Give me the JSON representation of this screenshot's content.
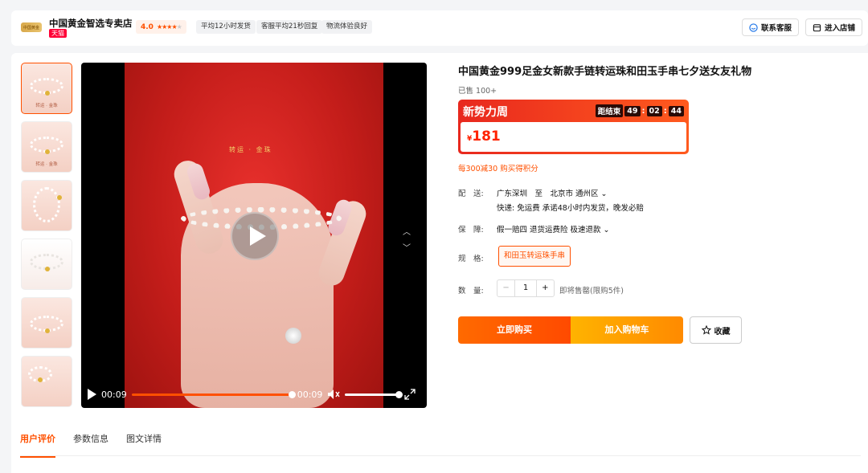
{
  "header": {
    "logo_text": "中国黄金",
    "store_name": "中国黄金智选专卖店",
    "platform_badge": "天猫",
    "rating": "4.0",
    "rating_stars": 4,
    "tags": [
      "平均12小时发货",
      "客服平均21秒回复",
      "物流体验良好"
    ],
    "contact_btn": "联系客服",
    "enter_store_btn": "进入店铺"
  },
  "gallery": {
    "thumbnails": [
      {
        "caption": "转运 · 金珠",
        "active": true
      },
      {
        "caption": "转运 · 金珠",
        "active": false
      },
      {
        "caption": "",
        "active": false
      },
      {
        "caption": "",
        "active": false
      },
      {
        "caption": "",
        "active": false
      },
      {
        "caption": "",
        "active": false
      }
    ]
  },
  "video": {
    "caption": "转运 · 金珠",
    "current_time": "00:09",
    "duration": "00:09",
    "progress": 1.0,
    "volume": 1.0
  },
  "product": {
    "title": "中国黄金999足金女新款手链转运珠和田玉手串七夕送女友礼物",
    "sold": "已售 100+",
    "promo": {
      "name": "新势力周",
      "countdown_label": "距结束",
      "hours": "49",
      "minutes": "02",
      "seconds": "44"
    },
    "price_currency": "¥",
    "price": "181",
    "coupon": "每300减30 购买得积分",
    "delivery_label": "配　送:",
    "delivery_route": "广东深圳　至　北京市 通州区 ⌄",
    "delivery_detail": "快递: 免运费  承诺48小时内发货，晚发必赔",
    "guarantee_label": "保　障:",
    "guarantee": "假一赔四  退货运费险  极速退款 ⌄",
    "spec_label": "规　格:",
    "spec_option": "和田玉转运珠手串",
    "qty_label": "数　量:",
    "qty_minus": "−",
    "qty_value": "1",
    "qty_plus": "+",
    "stock_note": "即将售罄(限购5件)",
    "buy_btn": "立即购买",
    "cart_btn": "加入购物车",
    "fav_btn": "收藏"
  },
  "tabs": [
    "用户评价",
    "参数信息",
    "图文详情"
  ],
  "colors": {
    "accent": "#ff5000",
    "tmall_red": "#ff0036",
    "promo_gradient_start": "#e8281e",
    "cart_orange": "#ffb300"
  }
}
